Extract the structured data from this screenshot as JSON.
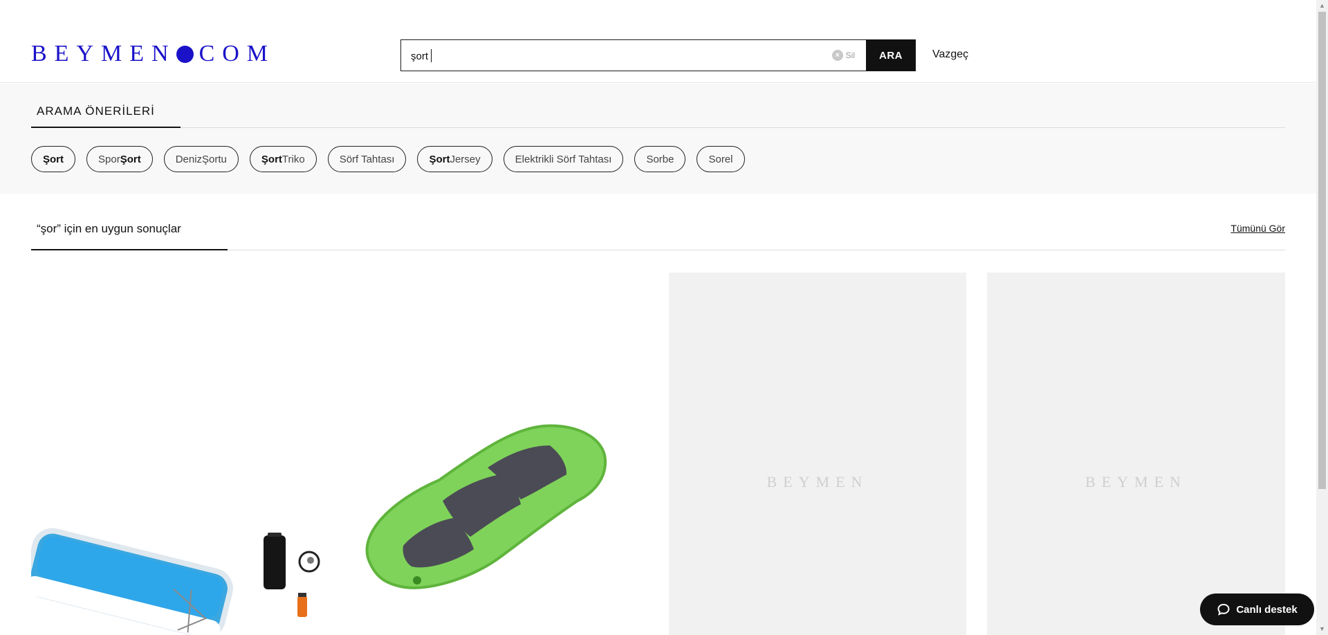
{
  "header": {
    "logo_left": "BEYMEN",
    "logo_right": "COM",
    "search_value": "şort",
    "clear_label": "Sil",
    "search_button": "ARA",
    "cancel_label": "Vazgeç"
  },
  "suggestions": {
    "title": "ARAMA ÖNERİLERİ",
    "chips": [
      {
        "bold": "Şort",
        "rest": ""
      },
      {
        "pre": "Spor ",
        "bold": "Şort",
        "rest": ""
      },
      {
        "pre": "Deniz ",
        "bold": "",
        "rest": "Şortu"
      },
      {
        "bold": "Şort",
        "rest": " Triko"
      },
      {
        "bold": "",
        "rest": "Sörf Tahtası"
      },
      {
        "bold": "Şort",
        "rest": " Jersey"
      },
      {
        "bold": "",
        "rest": "Elektrikli Sörf Tahtası"
      },
      {
        "bold": "",
        "rest": "Sorbe"
      },
      {
        "bold": "",
        "rest": "Sorel"
      }
    ]
  },
  "results": {
    "title": "“şor” için en uygun sonuçlar",
    "see_all": "Tümünü Gör",
    "placeholder_logo": "BEYMEN"
  },
  "support": {
    "label": "Canlı destek",
    "icon": "chat-bubble-icon"
  },
  "colors": {
    "brand": "#1a12c8",
    "button": "#111111",
    "card_placeholder": "#f1f1f1",
    "suggestion_bg": "#f8f8f8"
  }
}
